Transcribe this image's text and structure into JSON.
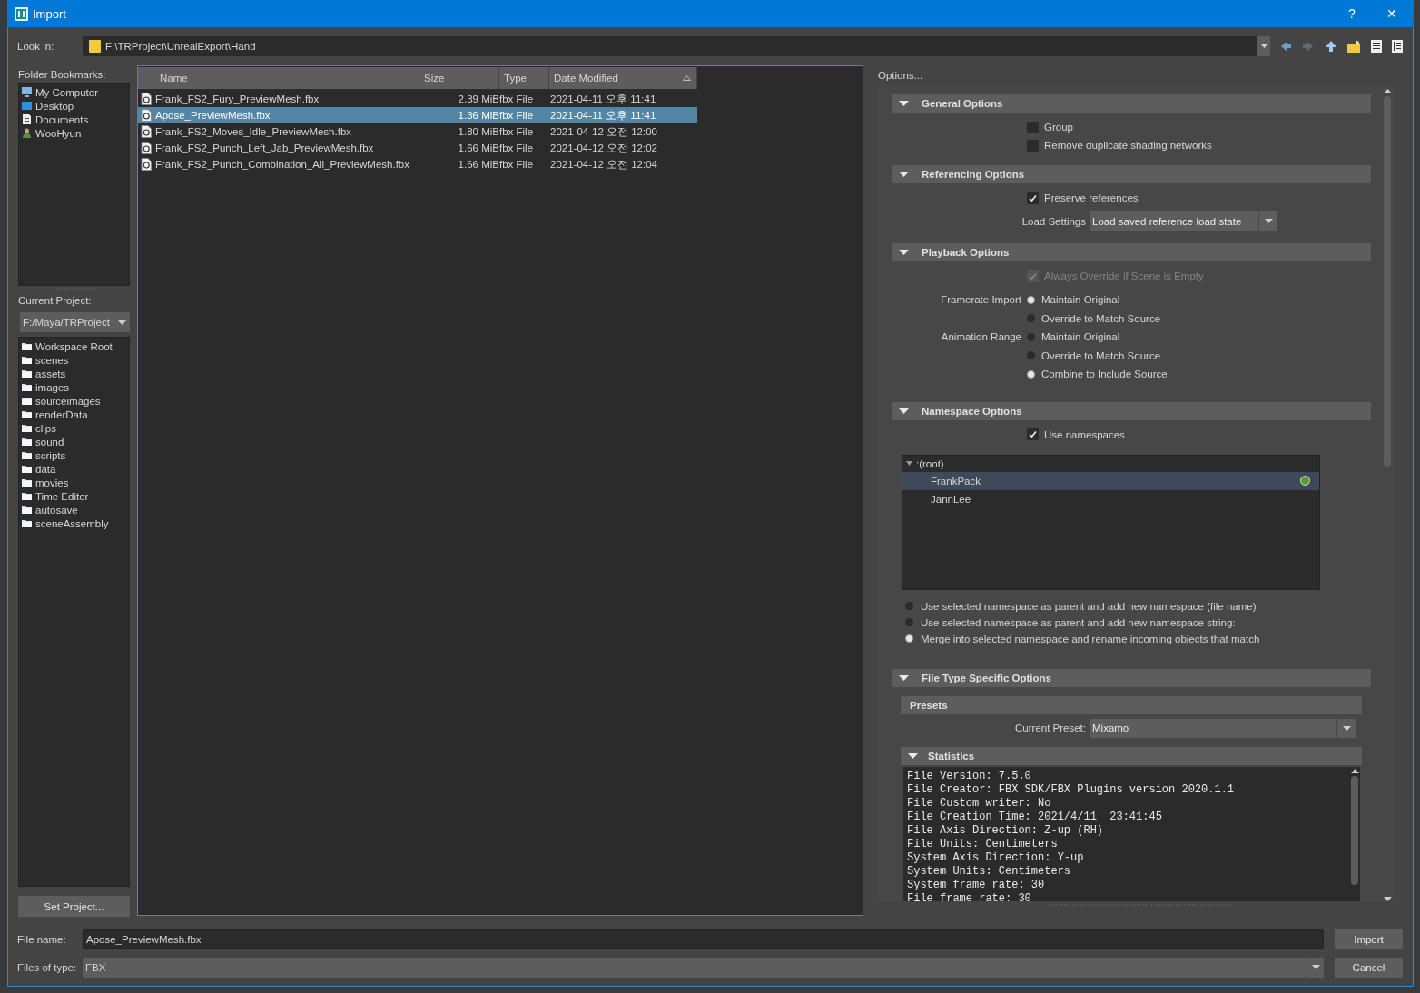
{
  "window": {
    "title": "Import",
    "help_label": "?",
    "close_label": "✕"
  },
  "look_in": {
    "label": "Look in:",
    "value": "F:\\TRProject\\UnrealExport\\Hand"
  },
  "folder_bookmarks": {
    "label": "Folder Bookmarks:",
    "items": [
      {
        "label": "My Computer",
        "kind": "computer"
      },
      {
        "label": "Desktop",
        "kind": "desktop"
      },
      {
        "label": "Documents",
        "kind": "documents"
      },
      {
        "label": "WooHyun",
        "kind": "user"
      }
    ]
  },
  "current_project": {
    "label": "Current Project:",
    "value": "F:/Maya/TRProject"
  },
  "project_folders": [
    "Workspace Root",
    "scenes",
    "assets",
    "images",
    "sourceimages",
    "renderData",
    "clips",
    "sound",
    "scripts",
    "data",
    "movies",
    "Time Editor",
    "autosave",
    "sceneAssembly"
  ],
  "set_project_button": "Set Project...",
  "file_table": {
    "columns": [
      "Name",
      "Size",
      "Type",
      "Date Modified"
    ],
    "rows": [
      {
        "name": "Frank_FS2_Fury_PreviewMesh.fbx",
        "size": "2.39 MiB",
        "type": "fbx File",
        "date": "2021-04-11 오후 11:41",
        "selected": false
      },
      {
        "name": "Apose_PreviewMesh.fbx",
        "size": "1.36 MiB",
        "type": "fbx File",
        "date": "2021-04-11 오후 11:41",
        "selected": true
      },
      {
        "name": "Frank_FS2_Moves_Idle_PreviewMesh.fbx",
        "size": "1.80 MiB",
        "type": "fbx File",
        "date": "2021-04-12 오전 12:00",
        "selected": false
      },
      {
        "name": "Frank_FS2_Punch_Left_Jab_PreviewMesh.fbx",
        "size": "1.66 MiB",
        "type": "fbx File",
        "date": "2021-04-12 오전 12:02",
        "selected": false
      },
      {
        "name": "Frank_FS2_Punch_Combination_All_PreviewMesh.fbx",
        "size": "1.66 MiB",
        "type": "fbx File",
        "date": "2021-04-12 오전 12:04",
        "selected": false
      }
    ]
  },
  "options": {
    "title": "Options...",
    "sections": [
      {
        "title": "General Options",
        "expanded": true,
        "items": [
          {
            "kind": "checkbox",
            "label": "Group",
            "checked": false,
            "disabled": false
          },
          {
            "kind": "checkbox",
            "label": "Remove duplicate shading networks",
            "checked": false,
            "disabled": false
          }
        ]
      },
      {
        "title": "Referencing Options",
        "expanded": true,
        "items": [
          {
            "kind": "checkbox",
            "label": "Preserve references",
            "checked": true,
            "disabled": false
          },
          {
            "kind": "dropdown",
            "label": "Load Settings",
            "value": "Load saved reference load state"
          }
        ]
      },
      {
        "title": "Playback Options",
        "expanded": true,
        "items": [
          {
            "kind": "checkbox",
            "label": "Always Override if Scene is Empty",
            "checked": true,
            "disabled": true
          },
          {
            "kind": "radio_group",
            "label": "Framerate Import",
            "options": [
              {
                "label": "Maintain Original",
                "selected": true
              },
              {
                "label": "Override to Match Source",
                "selected": false
              }
            ]
          },
          {
            "kind": "radio_group",
            "label": "Animation Range",
            "options": [
              {
                "label": "Maintain Original",
                "selected": false
              },
              {
                "label": "Override to Match Source",
                "selected": false
              },
              {
                "label": "Combine to Include Source",
                "selected": true
              }
            ]
          }
        ]
      },
      {
        "title": "Namespace Options",
        "expanded": true,
        "items": [
          {
            "kind": "checkbox",
            "label": "Use namespaces",
            "checked": true,
            "disabled": false
          },
          {
            "kind": "tree",
            "label": ":(root)",
            "expanded": true,
            "children": [
              {
                "label": "FrankPack",
                "selected": true,
                "current": true
              },
              {
                "label": "JannLee",
                "selected": false,
                "current": false
              }
            ]
          },
          {
            "kind": "radio_list",
            "options": [
              {
                "label": "Use selected namespace as parent and add new namespace (file name)",
                "selected": false
              },
              {
                "label": "Use selected namespace as parent and add new namespace string:",
                "selected": false
              },
              {
                "label": "Merge into selected namespace and rename incoming objects that match",
                "selected": true
              }
            ]
          }
        ]
      },
      {
        "title": "File Type Specific Options",
        "expanded": true,
        "items": [
          {
            "kind": "subheader",
            "label": "Presets"
          },
          {
            "kind": "dropdown",
            "label": "Current Preset:",
            "value": "Mixamo"
          },
          {
            "kind": "statistics",
            "title": "Statistics",
            "expanded": true,
            "lines": [
              "File Version: 7.5.0",
              "File Creator: FBX SDK/FBX Plugins version 2020.1.1",
              "File Custom writer: No",
              "File Creation Time: 2021/4/11  23:41:45",
              "File Axis Direction: Z-up (RH)",
              "File Units: Centimeters",
              "System Axis Direction: Y-up",
              "System Units: Centimeters",
              "System frame rate: 30",
              "File frame rate: 30"
            ]
          }
        ]
      }
    ]
  },
  "file_name": {
    "label": "File name:",
    "value": "Apose_PreviewMesh.fbx"
  },
  "files_of_type": {
    "label": "Files of type:",
    "value": "FBX"
  },
  "buttons": [
    "Import",
    "Cancel"
  ]
}
